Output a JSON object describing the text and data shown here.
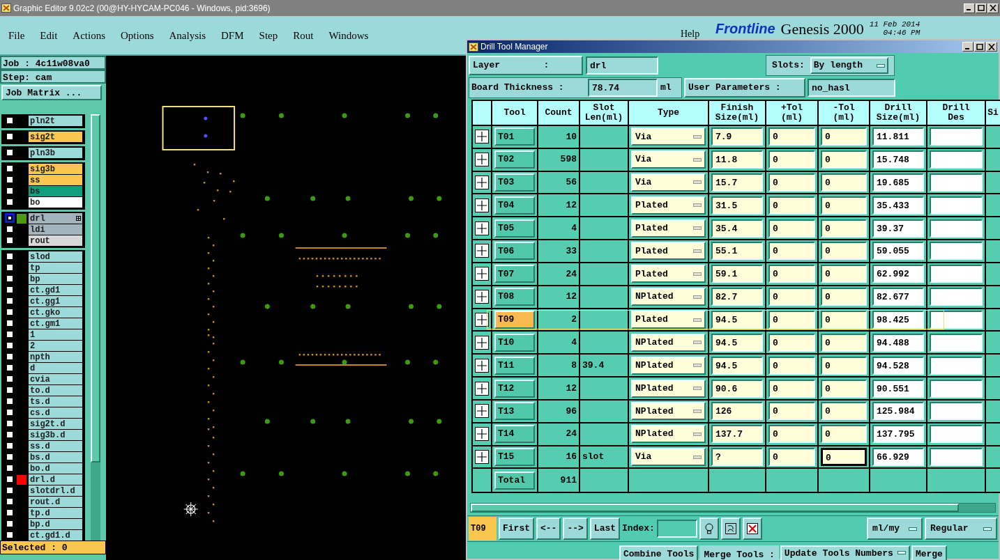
{
  "window": {
    "title": "Graphic Editor 9.02c2 (00@HY-HYCAM-PC046 - Windows, pid:3696)"
  },
  "menu": [
    "File",
    "Edit",
    "Actions",
    "Options",
    "Analysis",
    "DFM",
    "Step",
    "Rout",
    "Windows"
  ],
  "header": {
    "help": "Help",
    "logo": "Frontline",
    "product": "Genesis 2000",
    "date": "11 Feb 2014",
    "time": "04:46 PM"
  },
  "job": {
    "job": "Job : 4c11w08va0",
    "step": "Step: cam",
    "matrix_button": "Job Matrix ..."
  },
  "layer_groups": [
    [
      {
        "name": "pln2t",
        "color": "#9cd9d9",
        "selected": false
      }
    ],
    [
      {
        "name": "sig2t",
        "color": "#f9c650",
        "selected": false
      }
    ],
    [
      {
        "name": "pln3b",
        "color": "#9cd9d9",
        "selected": false
      }
    ],
    [
      {
        "name": "sig3b",
        "color": "#f9c650",
        "selected": false
      },
      {
        "name": "ss",
        "color": "#f9c650",
        "selected": false
      },
      {
        "name": "bs",
        "color": "#10a080",
        "selected": false
      },
      {
        "name": "bo",
        "color": "#ffffff",
        "selected": false
      }
    ],
    [
      {
        "name": "drl",
        "color": "#a3b4bc",
        "selected": true,
        "swatch": {
          "color": "#4c9a10"
        }
      },
      {
        "name": "ldi",
        "color": "#a3b4bc",
        "selected": false
      },
      {
        "name": "rout",
        "color": "#d8d8d8",
        "selected": false
      }
    ],
    [
      {
        "name": "slod",
        "color": "#9cd9d9",
        "selected": false
      },
      {
        "name": "tp",
        "color": "#9cd9d9",
        "selected": false
      },
      {
        "name": "bp",
        "color": "#9cd9d9",
        "selected": false
      },
      {
        "name": "ct.gd1",
        "color": "#9cd9d9",
        "selected": false
      },
      {
        "name": "ct.gg1",
        "color": "#9cd9d9",
        "selected": false
      },
      {
        "name": "ct.gko",
        "color": "#9cd9d9",
        "selected": false
      },
      {
        "name": "ct.gm1",
        "color": "#9cd9d9",
        "selected": false
      },
      {
        "name": "1",
        "color": "#9cd9d9",
        "selected": false
      },
      {
        "name": "2",
        "color": "#9cd9d9",
        "selected": false
      },
      {
        "name": "npth",
        "color": "#9cd9d9",
        "selected": false
      },
      {
        "name": "d",
        "color": "#9cd9d9",
        "selected": false
      },
      {
        "name": "cvia",
        "color": "#9cd9d9",
        "selected": false
      },
      {
        "name": "to.d",
        "color": "#9cd9d9",
        "selected": false
      },
      {
        "name": "ts.d",
        "color": "#9cd9d9",
        "selected": false
      },
      {
        "name": "cs.d",
        "color": "#9cd9d9",
        "selected": false
      },
      {
        "name": "sig2t.d",
        "color": "#9cd9d9",
        "selected": false
      },
      {
        "name": "sig3b.d",
        "color": "#9cd9d9",
        "selected": false
      },
      {
        "name": "ss.d",
        "color": "#9cd9d9",
        "selected": false
      },
      {
        "name": "bs.d",
        "color": "#9cd9d9",
        "selected": false
      },
      {
        "name": "bo.d",
        "color": "#9cd9d9",
        "selected": false
      },
      {
        "name": "drl.d",
        "color": "#9cd9d9",
        "selected": false,
        "swatch": {
          "color": "#ff0000"
        }
      },
      {
        "name": "slotdrl.d",
        "color": "#9cd9d9",
        "selected": false
      },
      {
        "name": "rout.d",
        "color": "#9cd9d9",
        "selected": false
      },
      {
        "name": "tp.d",
        "color": "#9cd9d9",
        "selected": false
      },
      {
        "name": "bp.d",
        "color": "#9cd9d9",
        "selected": false
      },
      {
        "name": "ct.gd1.d",
        "color": "#9cd9d9",
        "selected": false
      }
    ]
  ],
  "selected_status": "Selected : 0",
  "dialog": {
    "title": "Drill Tool Manager",
    "layer_label": "Layer        :",
    "layer_value": "drl",
    "slots_label": "Slots:",
    "slots_value": "By length",
    "thickness_label": "Board Thickness :",
    "thickness_value": "78.74",
    "thickness_unit": "ml",
    "user_params_button": "User Parameters :",
    "user_params_value": "no_hasl",
    "columns": [
      "Tool",
      "Count",
      "Slot\nLen(ml)",
      "Type",
      "Finish\nSize(ml)",
      "+Tol\n(ml)",
      "-Tol\n(ml)",
      "Drill\nSize(ml)",
      "Drill\nDes",
      "Si"
    ],
    "rows": [
      {
        "tool": "T01",
        "count": "10",
        "type": "Via",
        "finish": "7.9",
        "ptol": "0",
        "ntol": "0",
        "drill": "11.811",
        "selected": false,
        "focused": false
      },
      {
        "tool": "T02",
        "count": "598",
        "type": "Via",
        "finish": "11.8",
        "ptol": "0",
        "ntol": "0",
        "drill": "15.748",
        "selected": false,
        "focused": false
      },
      {
        "tool": "T03",
        "count": "56",
        "type": "Via",
        "finish": "15.7",
        "ptol": "0",
        "ntol": "0",
        "drill": "19.685",
        "selected": false,
        "focused": false
      },
      {
        "tool": "T04",
        "count": "12",
        "type": "Plated",
        "finish": "31.5",
        "ptol": "0",
        "ntol": "0",
        "drill": "35.433",
        "selected": false,
        "focused": false
      },
      {
        "tool": "T05",
        "count": "4",
        "type": "Plated",
        "finish": "35.4",
        "ptol": "0",
        "ntol": "0",
        "drill": "39.37",
        "selected": false,
        "focused": false
      },
      {
        "tool": "T06",
        "count": "33",
        "type": "Plated",
        "finish": "55.1",
        "ptol": "0",
        "ntol": "0",
        "drill": "59.055",
        "selected": false,
        "focused": false
      },
      {
        "tool": "T07",
        "count": "24",
        "type": "Plated",
        "finish": "59.1",
        "ptol": "0",
        "ntol": "0",
        "drill": "62.992",
        "selected": false,
        "focused": false
      },
      {
        "tool": "T08",
        "count": "12",
        "type": "NPlated",
        "finish": "82.7",
        "ptol": "0",
        "ntol": "0",
        "drill": "82.677",
        "selected": false,
        "focused": false
      },
      {
        "tool": "T09",
        "count": "2",
        "type": "Plated",
        "finish": "94.5",
        "ptol": "0",
        "ntol": "0",
        "drill": "98.425",
        "selected": true,
        "focused": false
      },
      {
        "tool": "T10",
        "count": "4",
        "type": "NPlated",
        "finish": "94.5",
        "ptol": "0",
        "ntol": "0",
        "drill": "94.488",
        "selected": false,
        "focused": false
      },
      {
        "tool": "T11",
        "count": "8",
        "slot": "39.4",
        "type": "NPlated",
        "finish": "94.5",
        "ptol": "0",
        "ntol": "0",
        "drill": "94.528",
        "selected": false,
        "focused": false
      },
      {
        "tool": "T12",
        "count": "12",
        "type": "NPlated",
        "finish": "90.6",
        "ptol": "0",
        "ntol": "0",
        "drill": "90.551",
        "selected": false,
        "focused": false
      },
      {
        "tool": "T13",
        "count": "96",
        "type": "NPlated",
        "finish": "126",
        "ptol": "0",
        "ntol": "0",
        "drill": "125.984",
        "selected": false,
        "focused": false
      },
      {
        "tool": "T14",
        "count": "24",
        "type": "NPlated",
        "finish": "137.7",
        "ptol": "0",
        "ntol": "0",
        "drill": "137.795",
        "selected": false,
        "focused": false
      },
      {
        "tool": "T15",
        "count": "16",
        "slot": "slot",
        "type": "Via",
        "finish": "?",
        "ptol": "0",
        "ntol": "0",
        "drill": "66.929",
        "selected": false,
        "focused": true
      }
    ],
    "total_label": "Total",
    "total_count": "911",
    "current_tool": "T09",
    "nav": [
      "First",
      "<--",
      "-->",
      "Last"
    ],
    "index_label": "Index:",
    "units": "ml/my",
    "mode": "Regular",
    "bottom": [
      {
        "kind": "button",
        "label": "Combine Tools"
      },
      {
        "kind": "label",
        "label": "Merge Tools :"
      },
      {
        "kind": "dropdown",
        "label": "Update Tools Numbers"
      },
      {
        "kind": "button",
        "label": "Merge"
      }
    ]
  }
}
